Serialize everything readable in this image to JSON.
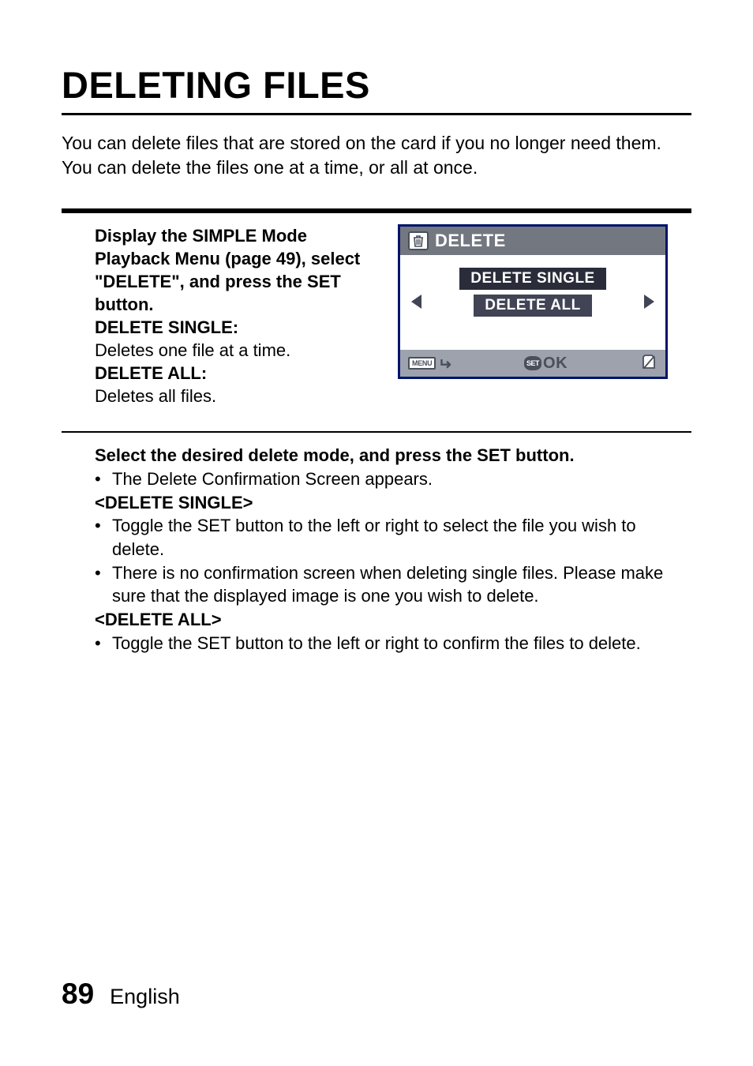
{
  "title": "DELETING FILES",
  "intro": "You can delete files that are stored on the card if you no longer need them. You can delete the files one at a time, or all at once.",
  "step1": {
    "instruction": "Display the SIMPLE Mode Playback Menu (page 49), select \"DELETE\", and press the SET button.",
    "opt1_label": "DELETE SINGLE:",
    "opt1_desc": "Deletes one file at a time.",
    "opt2_label": "DELETE ALL:",
    "opt2_desc": "Deletes all files."
  },
  "lcd": {
    "header": "DELETE",
    "option_single": "DELETE SINGLE",
    "option_all": "DELETE ALL",
    "menu_label": "MENU",
    "set_label": "SET",
    "ok_label": "OK"
  },
  "step2": {
    "instruction": "Select the desired delete mode, and press the SET button.",
    "bullet_top": "The Delete Confirmation Screen appears.",
    "single_heading": "<DELETE SINGLE>",
    "single_b1": "Toggle the SET button to the left or right to select the file you wish to delete.",
    "single_b2": "There is no confirmation screen when deleting single files. Please make sure that the displayed image is one you wish to delete.",
    "all_heading": "<DELETE ALL>",
    "all_b1": "Toggle the SET button to the left or right to confirm the files to delete."
  },
  "footer": {
    "page": "89",
    "language": "English"
  }
}
